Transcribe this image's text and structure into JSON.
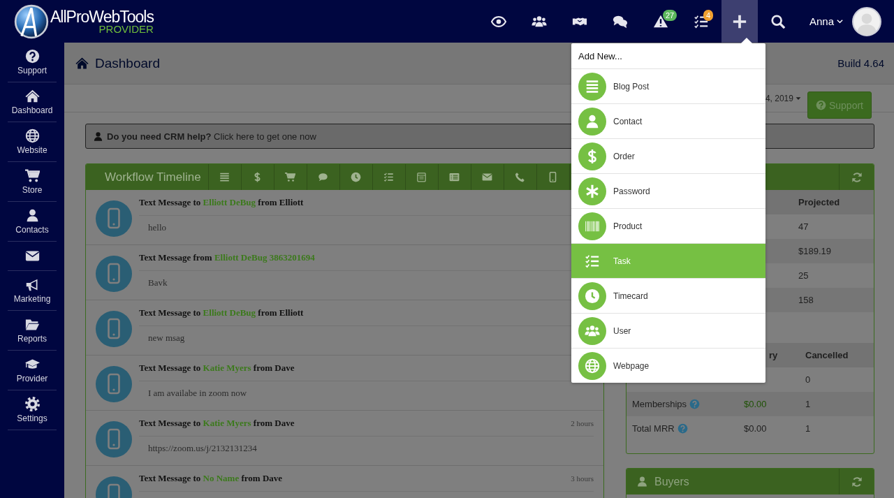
{
  "brand": {
    "name": "AllProWebTools",
    "subtitle": "PROVIDER"
  },
  "topbar": {
    "items": [
      {
        "kind": "eye",
        "selected": false
      },
      {
        "kind": "people",
        "selected": false
      },
      {
        "kind": "handshake",
        "selected": false
      },
      {
        "kind": "chat",
        "selected": false
      },
      {
        "kind": "warning",
        "badge": "27",
        "color": "#5cb85c",
        "selected": false
      },
      {
        "kind": "checklist",
        "badge": "4",
        "color": "#f0a030",
        "selected": false
      },
      {
        "kind": "plus",
        "selected": true
      },
      {
        "kind": "search",
        "selected": false
      }
    ],
    "user": {
      "name": "Anna"
    }
  },
  "sidebar": {
    "items": [
      {
        "kind": "question",
        "label": "Support"
      },
      {
        "kind": "home",
        "label": "Dashboard"
      },
      {
        "kind": "globe",
        "label": "Website"
      },
      {
        "kind": "cart",
        "label": "Store"
      },
      {
        "kind": "person",
        "label": "Contacts"
      },
      {
        "kind": "envelope"
      },
      {
        "kind": "megaphone",
        "label": "Marketing"
      },
      {
        "kind": "folder",
        "label": "Reports"
      },
      {
        "kind": "graduation-cap",
        "label": "Provider"
      },
      {
        "kind": "gear",
        "label": "Settings"
      }
    ]
  },
  "page": {
    "title": "Dashboard",
    "build": "Build 4.64",
    "date": "4, 2019",
    "support_button": "Support"
  },
  "banner": {
    "text": "**Do you need CRM help?** Click here to get one now"
  },
  "timeline": {
    "title": "Workflow Timeline",
    "filters": [
      {
        "kind": "list"
      },
      {
        "kind": "dollar"
      },
      {
        "kind": "cart"
      },
      {
        "kind": "speech"
      },
      {
        "kind": "clock"
      },
      {
        "kind": "checklist"
      },
      {
        "kind": "calendar"
      },
      {
        "kind": "list-card"
      },
      {
        "kind": "envelope"
      },
      {
        "kind": "phone"
      },
      {
        "kind": "mobile"
      }
    ],
    "entries": [
      {
        "before": "Text Message to",
        "contact": "Elliott DeBug",
        "after": "from Elliott",
        "body": "hello"
      },
      {
        "before": "Text Message from",
        "contact": "Elliott DeBug 3863201694",
        "body": "Bavk"
      },
      {
        "before": "Text Message to",
        "contact": "Elliott DeBug",
        "after": "from Elliott",
        "body": "new msag"
      },
      {
        "before": "Text Message to",
        "contact": "Katie Myers",
        "after": "from Dave",
        "body": "I am availabe in zoom now"
      },
      {
        "before": "Text Message to",
        "contact": "Katie Myers",
        "after": "from Dave",
        "body": "https://zoom.us/j/2132131234",
        "time": "2 hours"
      },
      {
        "before": "Text Message to",
        "contact": "No Name",
        "after": "from Dave",
        "time": "3 hours"
      }
    ]
  },
  "stats": {
    "projected": {
      "heading": "Projected",
      "values": [
        "47",
        "$189.19",
        "25",
        "158"
      ]
    },
    "recurring": {
      "headings": [
        "ry",
        "Cancelled"
      ],
      "rows": [
        {
          "cancelled": "0"
        },
        {
          "label": "Memberships",
          "help": true,
          "summary": "$0.00",
          "positive": true,
          "cancelled": "1"
        },
        {
          "label": "Total MRR",
          "help": true,
          "summary": "$0.00",
          "positive": false,
          "cancelled": "1"
        }
      ]
    }
  },
  "buyers": {
    "title": "Buyers"
  },
  "add_menu": {
    "heading": "Add New...",
    "items": [
      {
        "kind": "lines",
        "label": "Blog Post",
        "selected": false
      },
      {
        "kind": "person",
        "label": "Contact",
        "selected": false
      },
      {
        "kind": "dollar",
        "label": "Order",
        "selected": false
      },
      {
        "kind": "asterisk",
        "label": "Password",
        "selected": false
      },
      {
        "kind": "barcode",
        "label": "Product",
        "selected": false
      },
      {
        "kind": "checklist",
        "label": "Task",
        "selected": true
      },
      {
        "kind": "clock",
        "label": "Timecard",
        "selected": false
      },
      {
        "kind": "people",
        "label": "User",
        "selected": false
      },
      {
        "kind": "globe",
        "label": "Webpage",
        "selected": false
      }
    ]
  }
}
